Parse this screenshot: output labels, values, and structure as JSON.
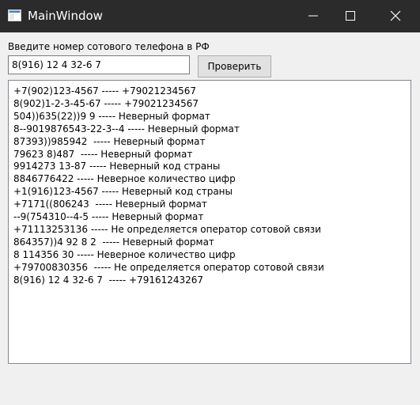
{
  "window": {
    "title": "MainWindow"
  },
  "form": {
    "prompt": "Введите номер сотового телефона в РФ",
    "phone_value": "8(916) 12 4 32-6 7",
    "check_label": "Проверить"
  },
  "results": [
    "+7(902)123-4567 ----- +79021234567",
    "8(902)1-2-3-45-67 ----- +79021234567",
    "504))635(22))9 9 ----- Неверный формат",
    "8--9019876543-22-3--4 ----- Неверный формат",
    "87393))985942  ----- Неверный формат",
    "79623 8)487  ----- Неверный формат",
    "9914273 13-87 ----- Неверный код страны",
    "8846776422 ----- Неверное количество цифр",
    "+1(916)123-4567 ----- Неверный код страны",
    "+7171((806243  ----- Неверный формат",
    "--9(754310--4-5 ----- Неверный формат",
    "+71113253136 ----- Не определяется оператор сотовой связи",
    "864357))4 92 8 2  ----- Неверный формат",
    "8 114356 30 ----- Неверное количество цифр",
    "+79700830356  ----- Не определяется оператор сотовой связи",
    "8(916) 12 4 32-6 7  ----- +79161243267"
  ],
  "colors": {
    "titlebar": "#2b2b2b",
    "window_bg": "#f0f0f0"
  }
}
